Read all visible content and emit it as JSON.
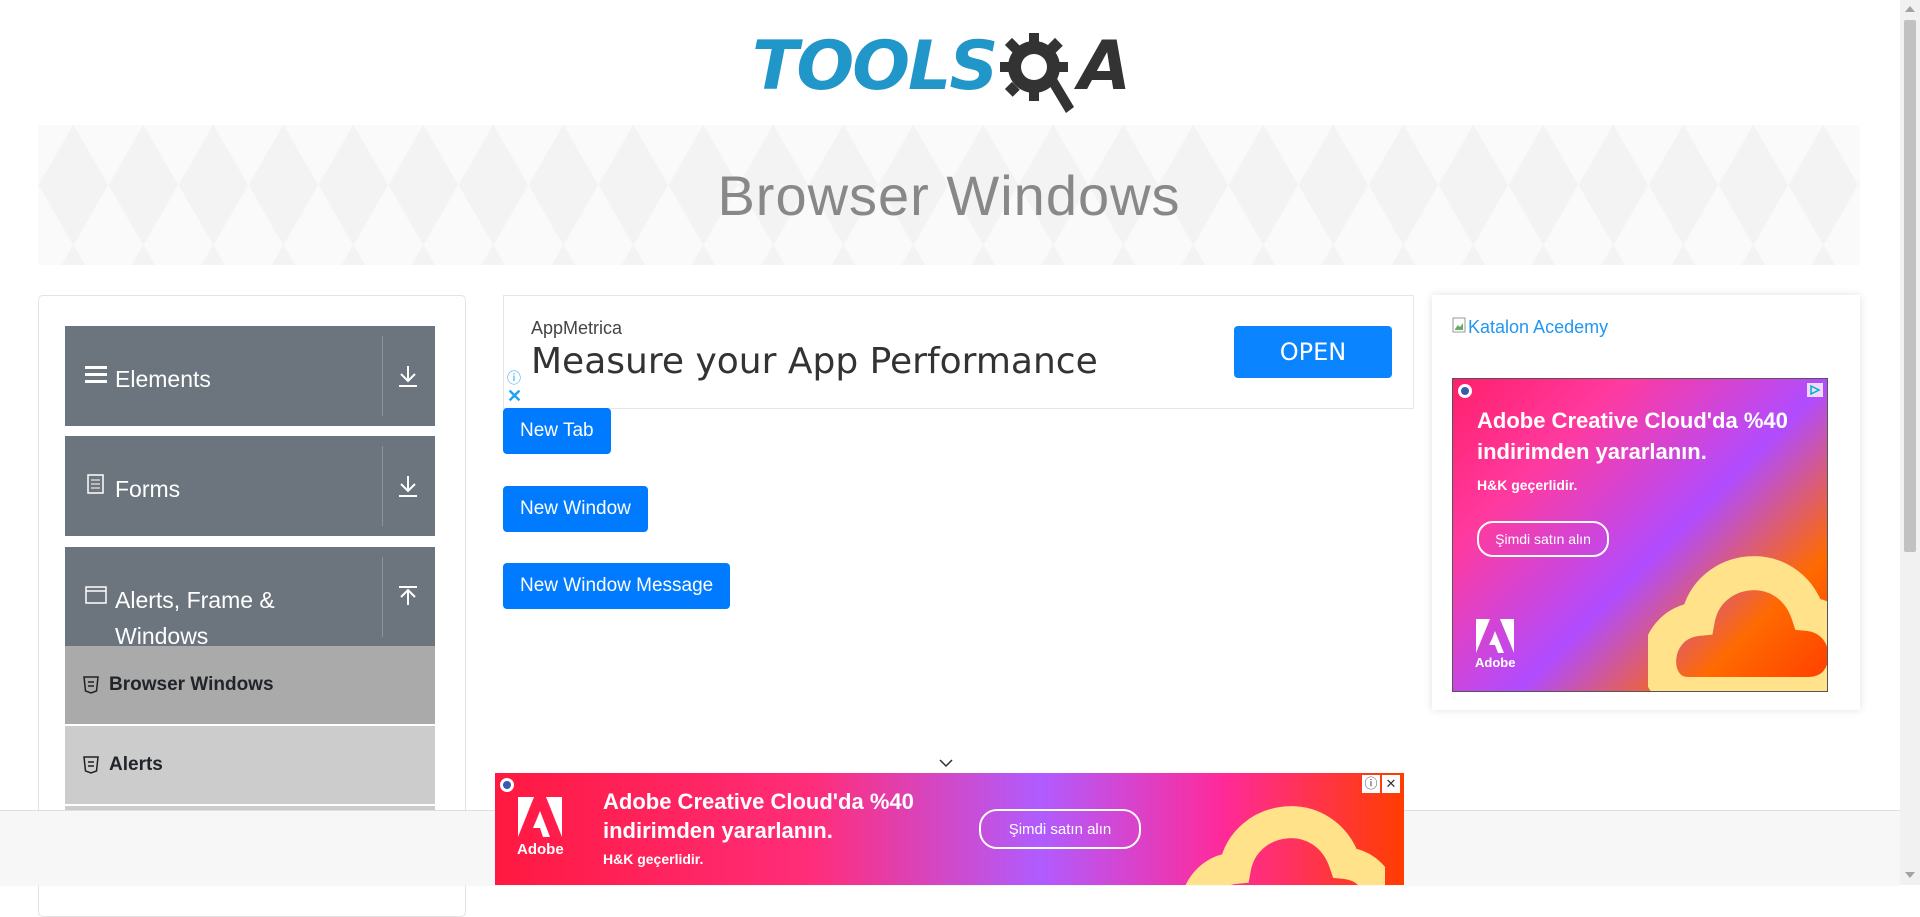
{
  "header": {
    "logo_left": "TOOLS",
    "logo_right": "A",
    "page_title": "Browser Windows"
  },
  "sidebar": {
    "groups": [
      {
        "label": "Elements",
        "icon": "hamburger-icon",
        "state": "collapsed"
      },
      {
        "label": "Forms",
        "icon": "document-icon",
        "state": "collapsed"
      },
      {
        "label": "Alerts, Frame & Windows",
        "icon": "window-icon",
        "state": "expanded"
      }
    ],
    "subitems": [
      {
        "label": "Browser Windows",
        "active": true
      },
      {
        "label": "Alerts",
        "active": false
      }
    ]
  },
  "top_ad": {
    "brand": "AppMetrica",
    "headline": "Measure your App Performance",
    "cta": "OPEN"
  },
  "buttons": {
    "new_tab": "New Tab",
    "new_window": "New Window",
    "new_window_message": "New Window Message"
  },
  "right_column": {
    "katalon_alt": "Katalon Acedemy",
    "adobe_ad": {
      "headline": "Adobe Creative Cloud'da %40 indirimden yararlanın.",
      "sub": "H&K geçerlidir.",
      "cta": "Şimdi satın alın",
      "logo_text": "Adobe"
    }
  },
  "bottom_ad": {
    "headline_line1": "Adobe Creative Cloud'da %40",
    "headline_line2": "indirimden yararlanın.",
    "sub": "H&K geçerlidir.",
    "cta": "Şimdi satın alın",
    "logo_text": "Adobe"
  },
  "colors": {
    "primary": "#007bff",
    "sidebar_group": "#6c757d",
    "active_item": "#aaaaaa",
    "inactive_item": "#cccccc",
    "logo_blue": "#2196c8"
  }
}
